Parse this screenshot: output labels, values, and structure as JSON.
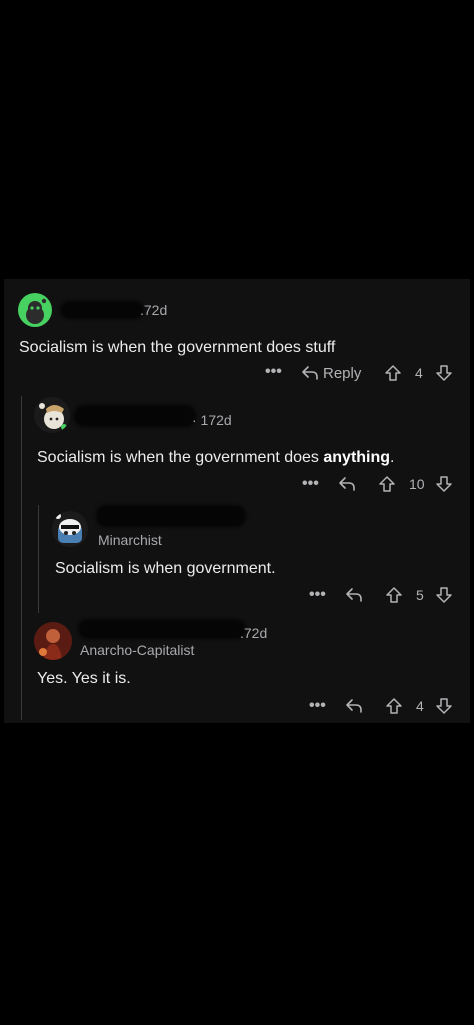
{
  "comments": [
    {
      "age": "172d",
      "age_display": ".72d",
      "flair": "",
      "text": "Socialism is when the government does stuff",
      "reply_label": "Reply",
      "votes": "4"
    },
    {
      "age": "172d",
      "age_display": "· 172d",
      "flair": "",
      "text_before": "Socialism is when the government does ",
      "text_bold": "anything",
      "text_after": ".",
      "votes": "10"
    },
    {
      "age": "",
      "flair": "Minarchist",
      "text": "Socialism is when government.",
      "votes": "5"
    },
    {
      "age": "172d",
      "age_display": ".72d",
      "flair": "Anarcho-Capitalist",
      "text": "Yes. Yes it is.",
      "votes": "4"
    }
  ],
  "icons": {
    "more": "more-options-icon",
    "reply": "reply-arrow-icon",
    "upvote": "upvote-arrow-icon",
    "downvote": "downvote-arrow-icon"
  },
  "colors": {
    "background": "#000000",
    "panel": "#111112",
    "text": "#ececec",
    "muted": "#a9a9ad",
    "avatar_green": "#46d160"
  }
}
